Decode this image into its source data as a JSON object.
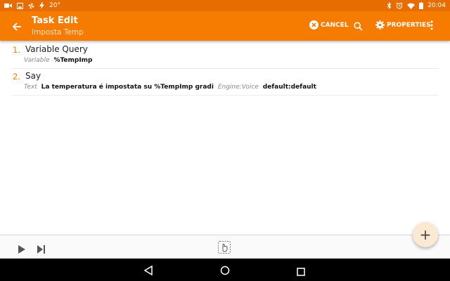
{
  "status_bar": {
    "temperature": "20°",
    "time": "20:04",
    "icons": [
      "video-icon",
      "image-icon",
      "pinwheel-icon",
      "bolt-icon",
      "bluetooth-icon",
      "alarm-icon",
      "wifi-icon",
      "battery-icon"
    ]
  },
  "header": {
    "title": "Task Edit",
    "subtitle": "Imposta Temp",
    "cancel_label": "CANCEL",
    "properties_label": "PROPERTIES"
  },
  "actions": [
    {
      "number": "1.",
      "name": "Variable Query",
      "args": [
        {
          "label": "Variable",
          "value": "%TempImp"
        }
      ]
    },
    {
      "number": "2.",
      "name": "Say",
      "args": [
        {
          "label": "Text",
          "value": "La temperatura é impostata su %TempImp gradi"
        },
        {
          "label": "Engine:Voice",
          "value": "default:default"
        }
      ]
    }
  ],
  "fab_symbol": "+",
  "colors": {
    "accent": "#f57c00",
    "status_bar": "#e86d00",
    "fab": "#fbe9d3"
  }
}
